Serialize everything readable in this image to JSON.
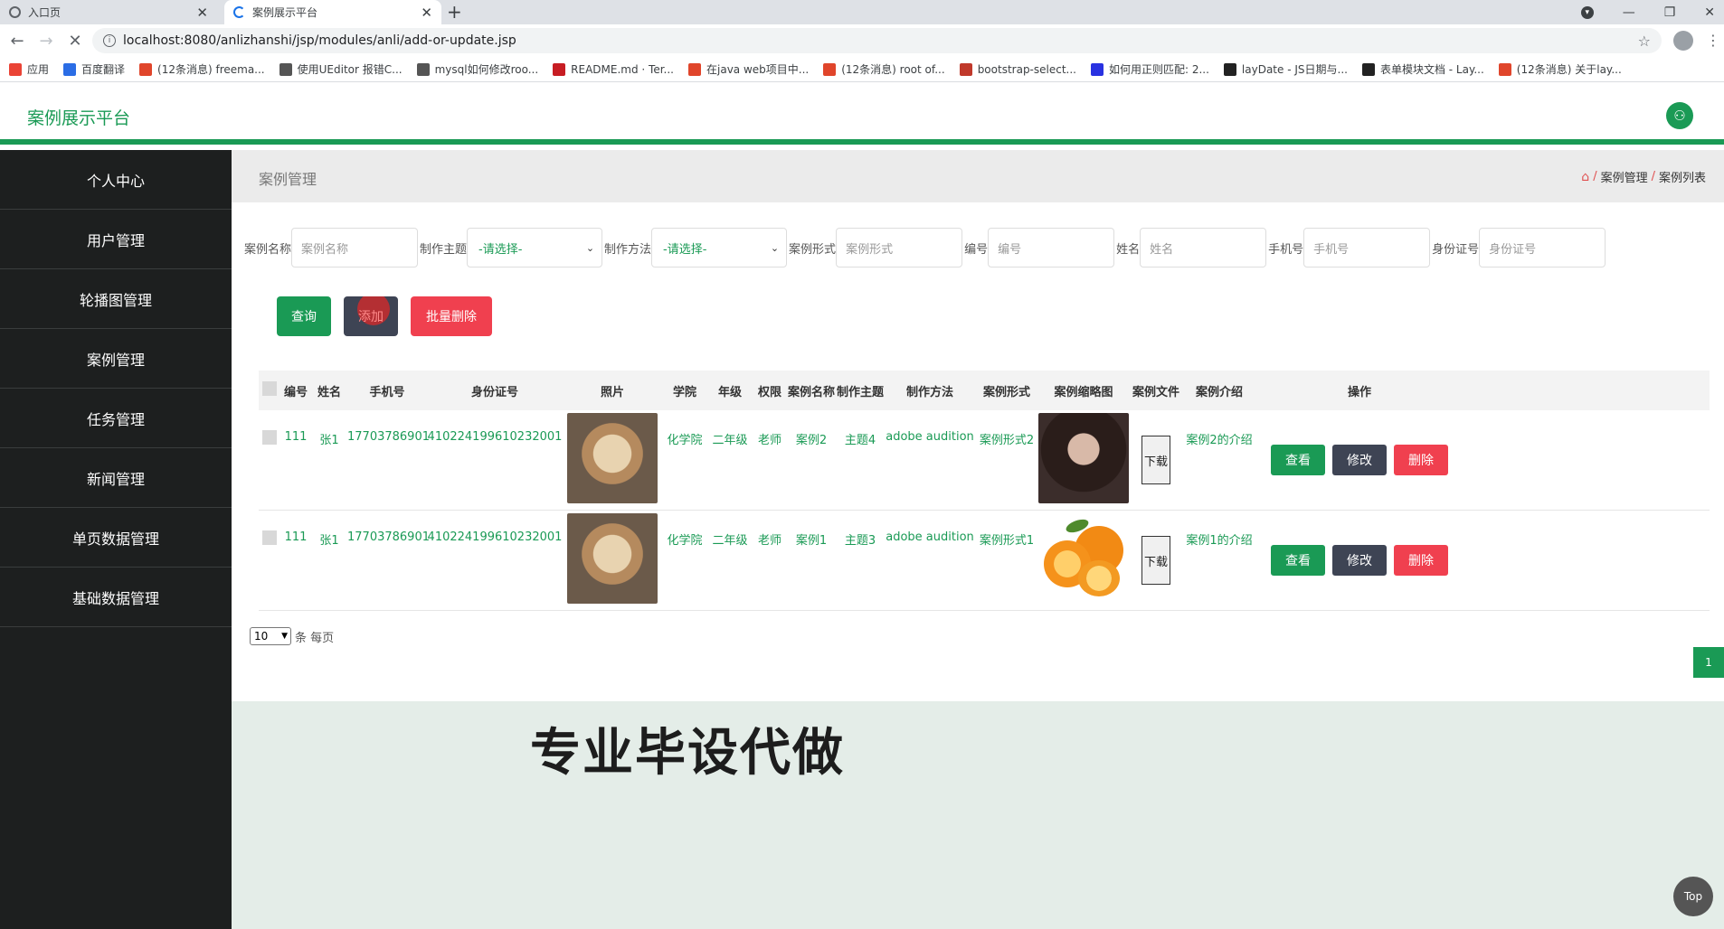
{
  "browser": {
    "tabs": [
      {
        "title": "入口页",
        "active": false
      },
      {
        "title": "案例展示平台",
        "active": true
      }
    ],
    "url": "localhost:8080/anlizhanshi/jsp/modules/anli/add-or-update.jsp",
    "bookmarks": [
      {
        "label": "应用",
        "icon": "apps-icon",
        "color": "#ea4335"
      },
      {
        "label": "百度翻译",
        "icon": "translate-icon",
        "color": "#2b6de5"
      },
      {
        "label": "(12条消息) freema...",
        "icon": "csdn-icon",
        "color": "#e0452b"
      },
      {
        "label": "使用UEditor 报错C...",
        "icon": "feather-icon",
        "color": "#555555"
      },
      {
        "label": "mysql如何修改roo...",
        "icon": "feather-icon",
        "color": "#555555"
      },
      {
        "label": "README.md · Ter...",
        "icon": "gitee-icon",
        "color": "#c71d23"
      },
      {
        "label": "在java web项目中...",
        "icon": "csdn-icon",
        "color": "#e0452b"
      },
      {
        "label": "(12条消息) root of...",
        "icon": "csdn-icon",
        "color": "#e0452b"
      },
      {
        "label": "bootstrap-select...",
        "icon": "cnblogs-icon",
        "color": "#c0392b"
      },
      {
        "label": "如何用正则匹配: 2...",
        "icon": "baidu-icon",
        "color": "#2932e1"
      },
      {
        "label": "layDate - JS日期与...",
        "icon": "layui-icon",
        "color": "#222222"
      },
      {
        "label": "表单模块文档 - Lay...",
        "icon": "layui-icon",
        "color": "#222222"
      },
      {
        "label": "(12条消息) 关于lay...",
        "icon": "csdn-icon",
        "color": "#e0452b"
      }
    ]
  },
  "app": {
    "title": "案例展示平台",
    "accent": "#1a9a55"
  },
  "sidebar": {
    "items": [
      {
        "label": "个人中心"
      },
      {
        "label": "用户管理"
      },
      {
        "label": "轮播图管理"
      },
      {
        "label": "案例管理"
      },
      {
        "label": "任务管理"
      },
      {
        "label": "新闻管理"
      },
      {
        "label": "单页数据管理"
      },
      {
        "label": "基础数据管理"
      }
    ]
  },
  "page": {
    "heading": "案例管理",
    "breadcrumb": [
      "案例管理",
      "案例列表"
    ]
  },
  "filters": {
    "case_name": {
      "label": "案例名称",
      "placeholder": "案例名称"
    },
    "theme": {
      "label": "制作主题",
      "value": "-请选择-"
    },
    "method": {
      "label": "制作方法",
      "value": "-请选择-"
    },
    "form": {
      "label": "案例形式",
      "placeholder": "案例形式"
    },
    "number": {
      "label": "编号",
      "placeholder": "编号"
    },
    "name": {
      "label": "姓名",
      "placeholder": "姓名"
    },
    "phone": {
      "label": "手机号",
      "placeholder": "手机号"
    },
    "id_card": {
      "label": "身份证号",
      "placeholder": "身份证号"
    }
  },
  "actions": {
    "search": "查询",
    "add": "添加",
    "batch_delete": "批量删除"
  },
  "table": {
    "headers": [
      "编号",
      "姓名",
      "手机号",
      "身份证号",
      "照片",
      "学院",
      "年级",
      "权限",
      "案例名称",
      "制作主题",
      "制作方法",
      "案例形式",
      "案例缩略图",
      "案例文件",
      "案例介绍",
      "操作"
    ],
    "rows": [
      {
        "number": "111",
        "name": "张1",
        "phone": "17703786901",
        "id_card": "410224199610232001",
        "photo": "cat-photo",
        "college": "化学院",
        "grade": "二年级",
        "role": "老师",
        "case_name": "案例2",
        "theme": "主题4",
        "method": "adobe audition",
        "form": "案例形式2",
        "thumb": "person-photo",
        "file_btn": "下载",
        "intro": "案例2的介绍",
        "view": "查看",
        "edit": "修改",
        "delete": "删除"
      },
      {
        "number": "111",
        "name": "张1",
        "phone": "17703786901",
        "id_card": "410224199610232001",
        "photo": "cat-photo",
        "college": "化学院",
        "grade": "二年级",
        "role": "老师",
        "case_name": "案例1",
        "theme": "主题3",
        "method": "adobe audition",
        "form": "案例形式1",
        "thumb": "orange-photo",
        "file_btn": "下载",
        "intro": "案例1的介绍",
        "view": "查看",
        "edit": "修改",
        "delete": "删除"
      }
    ]
  },
  "pagination": {
    "page_size": "10",
    "per_page_label": "条 每页",
    "current_page": "1"
  },
  "overlay": {
    "watermark": "专业毕设代做",
    "top_button": "Top"
  }
}
